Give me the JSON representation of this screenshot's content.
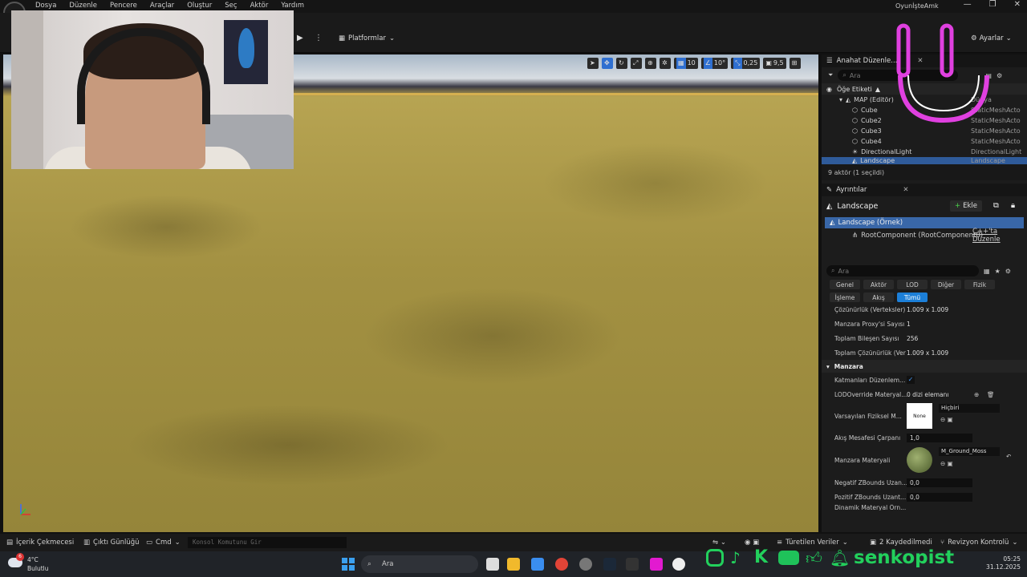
{
  "menubar": {
    "items": [
      "Dosya",
      "Düzenle",
      "Pencere",
      "Araçlar",
      "Oluştur",
      "Seç",
      "Aktör",
      "Yardım"
    ],
    "project": "OyunİşteAmk",
    "window_controls": [
      "—",
      "❐",
      "✕"
    ]
  },
  "toolbar": {
    "platforms_label": "Platformlar",
    "settings_label": "Ayarlar"
  },
  "viewport": {
    "tools": {
      "grid_snap": "10",
      "rotation_snap": "10°",
      "scale_snap": "0,25",
      "camera_speed": "9,5"
    }
  },
  "outliner": {
    "tab_title": "Anahat Düzenle...",
    "search_placeholder": "Ara",
    "column_label": "Öğe Etiketi",
    "column_type": "Tür",
    "map_label": "MAP (Editör)",
    "map_type": "Dünya",
    "items": [
      {
        "label": "Cube",
        "type": "StaticMeshActo"
      },
      {
        "label": "Cube2",
        "type": "StaticMeshActo"
      },
      {
        "label": "Cube3",
        "type": "StaticMeshActo"
      },
      {
        "label": "Cube4",
        "type": "StaticMeshActo"
      },
      {
        "label": "DirectionalLight",
        "type": "DirectionalLight"
      },
      {
        "label": "Landscape",
        "type": "Landscape"
      }
    ],
    "status": "9 aktör (1 seçildi)"
  },
  "details": {
    "tab_title": "Ayrıntılar",
    "actor_name": "Landscape",
    "add_label": "Ekle",
    "component_selected": "Landscape (Örnek)",
    "component_root": "RootComponent (RootComponent0)",
    "cpp_edit": "C++'ta Düzenle",
    "search_placeholder": "Ara",
    "filters_row1": [
      "Genel",
      "Aktör",
      "LOD",
      "Diğer",
      "Fizik"
    ],
    "filters_row2": [
      "İşleme",
      "Akış",
      "Tümü"
    ],
    "props_top": [
      {
        "label": "Çözünürlük (Verteksler)",
        "value": "1.009 x 1.009"
      },
      {
        "label": "Manzara Proxy'si Sayısı",
        "value": "1"
      },
      {
        "label": "Toplam Bileşen Sayısı",
        "value": "256"
      },
      {
        "label": "Toplam Çözünürlük (Ver",
        "value": "1.009 x 1.009"
      }
    ],
    "section_label": "Manzara",
    "layers_label": "Katmanları Düzenlem...",
    "lod_label": "LODOverride Materyal...",
    "lod_value": "0 dizi elemanı",
    "phys_label": "Varsayılan Fiziksel M...",
    "phys_thumb": "None",
    "phys_value": "Hiçbiri",
    "stream_label": "Akış Mesafesi Çarpanı",
    "stream_value": "1,0",
    "material_label": "Manzara Materyali",
    "material_value": "M_Ground_Moss",
    "negz_label": "Negatif ZBounds Uzan...",
    "negz_value": "0,0",
    "posz_label": "Pozitif ZBounds Uzant...",
    "posz_value": "0,0",
    "dyn_label": "Dinamik Materyal Örn..."
  },
  "statusbar": {
    "content_browser": "İçerik Çekmecesi",
    "output_log": "Çıktı Günlüğü",
    "cmd": "Cmd",
    "console_placeholder": "Konsol Komutunu Gir",
    "derived": "Türetilen Veriler",
    "saved": "2 Kaydedilmedi",
    "revision": "Revizyon Kontrolü"
  },
  "taskbar": {
    "temperature": "4°C",
    "weather": "Bulutlu",
    "weather_badge": "6",
    "search": "Ara",
    "time": "05:25",
    "date": "31.12.2025"
  },
  "overlay": {
    "handle": "senkopist",
    "accent": "#22d05c",
    "smiley_color": "#e040e0"
  }
}
